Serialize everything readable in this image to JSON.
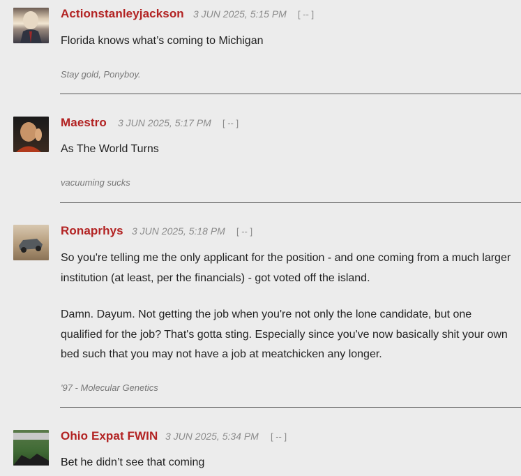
{
  "comments": [
    {
      "username": "Actionstanleyjackson",
      "timestamp": "3 JUN 2025, 5:15 PM",
      "collapse": "[ -- ]",
      "body": [
        "Florida knows what’s coming to Michigan"
      ],
      "signature": "Stay gold, Ponyboy."
    },
    {
      "username": "Maestro",
      "timestamp": "3 JUN 2025, 5:17 PM",
      "collapse": "[ -- ]",
      "body": [
        "As The World Turns"
      ],
      "signature": "vacuuming sucks"
    },
    {
      "username": "Ronaprhys",
      "timestamp": "3 JUN 2025, 5:18 PM",
      "collapse": "[ -- ]",
      "body": [
        "So you're telling me the only applicant for the position - and one coming from a much larger institution (at least, per the financials) - got voted off the island.",
        "Damn.  Dayum.  Not getting the job when you're not only the lone candidate, but one qualified for the job?  That's gotta sting.  Especially since you've now basically shit your own bed such that you may not have a job at meatchicken any longer."
      ],
      "signature": "'97 - Molecular Genetics"
    },
    {
      "username": "Ohio Expat FWIN",
      "timestamp": "3 JUN 2025, 5:34 PM",
      "collapse": "[ -- ]",
      "body_bold": "Bet",
      "body_rest": " he didn’t see that coming"
    }
  ]
}
